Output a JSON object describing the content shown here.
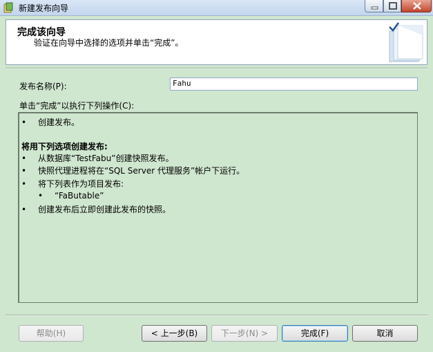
{
  "window": {
    "title": "新建发布向导"
  },
  "header": {
    "title": "完成该向导",
    "subtitle": "验证在向导中选择的选项并单击“完成”。"
  },
  "form": {
    "publication_name_label": "发布名称(P):",
    "publication_name_value": "Fahu",
    "actions_label": "单击“完成”以执行下列操作(C):"
  },
  "summary": {
    "bullet": "•",
    "line1": "创建发布。",
    "section_heading": "将用下列选项创建发布:",
    "line2": "从数据库“TestFabu”创建快照发布。",
    "line3": "快照代理进程将在“SQL Server 代理服务”帐户下运行。",
    "line4": "将下列表作为项目发布:",
    "sub_item": "“FaButable”",
    "line5": "创建发布后立即创建此发布的快照。"
  },
  "buttons": {
    "help": "帮助(H)",
    "back": "< 上一步(B)",
    "next": "下一步(N) >",
    "finish": "完成(F)",
    "cancel": "取消"
  },
  "icons": {
    "app": "wizard-app-icon",
    "minimize": "minimize-icon",
    "maximize": "maximize-icon",
    "close": "close-icon",
    "header": "book-check-icon"
  }
}
